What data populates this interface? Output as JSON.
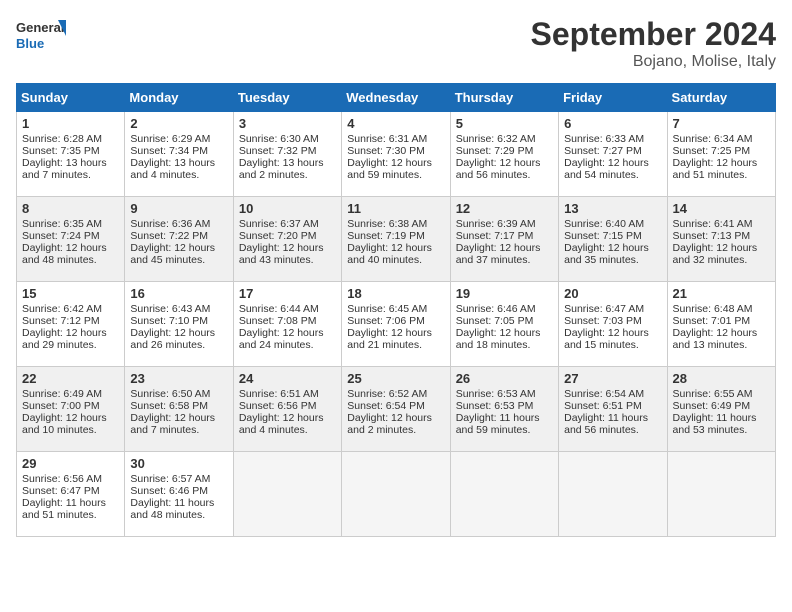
{
  "logo": {
    "line1": "General",
    "line2": "Blue"
  },
  "title": "September 2024",
  "location": "Bojano, Molise, Italy",
  "weekdays": [
    "Sunday",
    "Monday",
    "Tuesday",
    "Wednesday",
    "Thursday",
    "Friday",
    "Saturday"
  ],
  "weeks": [
    [
      {
        "day": "1",
        "sunrise": "6:28 AM",
        "sunset": "7:35 PM",
        "daylight": "13 hours and 7 minutes."
      },
      {
        "day": "2",
        "sunrise": "6:29 AM",
        "sunset": "7:34 PM",
        "daylight": "13 hours and 4 minutes."
      },
      {
        "day": "3",
        "sunrise": "6:30 AM",
        "sunset": "7:32 PM",
        "daylight": "13 hours and 2 minutes."
      },
      {
        "day": "4",
        "sunrise": "6:31 AM",
        "sunset": "7:30 PM",
        "daylight": "12 hours and 59 minutes."
      },
      {
        "day": "5",
        "sunrise": "6:32 AM",
        "sunset": "7:29 PM",
        "daylight": "12 hours and 56 minutes."
      },
      {
        "day": "6",
        "sunrise": "6:33 AM",
        "sunset": "7:27 PM",
        "daylight": "12 hours and 54 minutes."
      },
      {
        "day": "7",
        "sunrise": "6:34 AM",
        "sunset": "7:25 PM",
        "daylight": "12 hours and 51 minutes."
      }
    ],
    [
      {
        "day": "8",
        "sunrise": "6:35 AM",
        "sunset": "7:24 PM",
        "daylight": "12 hours and 48 minutes."
      },
      {
        "day": "9",
        "sunrise": "6:36 AM",
        "sunset": "7:22 PM",
        "daylight": "12 hours and 45 minutes."
      },
      {
        "day": "10",
        "sunrise": "6:37 AM",
        "sunset": "7:20 PM",
        "daylight": "12 hours and 43 minutes."
      },
      {
        "day": "11",
        "sunrise": "6:38 AM",
        "sunset": "7:19 PM",
        "daylight": "12 hours and 40 minutes."
      },
      {
        "day": "12",
        "sunrise": "6:39 AM",
        "sunset": "7:17 PM",
        "daylight": "12 hours and 37 minutes."
      },
      {
        "day": "13",
        "sunrise": "6:40 AM",
        "sunset": "7:15 PM",
        "daylight": "12 hours and 35 minutes."
      },
      {
        "day": "14",
        "sunrise": "6:41 AM",
        "sunset": "7:13 PM",
        "daylight": "12 hours and 32 minutes."
      }
    ],
    [
      {
        "day": "15",
        "sunrise": "6:42 AM",
        "sunset": "7:12 PM",
        "daylight": "12 hours and 29 minutes."
      },
      {
        "day": "16",
        "sunrise": "6:43 AM",
        "sunset": "7:10 PM",
        "daylight": "12 hours and 26 minutes."
      },
      {
        "day": "17",
        "sunrise": "6:44 AM",
        "sunset": "7:08 PM",
        "daylight": "12 hours and 24 minutes."
      },
      {
        "day": "18",
        "sunrise": "6:45 AM",
        "sunset": "7:06 PM",
        "daylight": "12 hours and 21 minutes."
      },
      {
        "day": "19",
        "sunrise": "6:46 AM",
        "sunset": "7:05 PM",
        "daylight": "12 hours and 18 minutes."
      },
      {
        "day": "20",
        "sunrise": "6:47 AM",
        "sunset": "7:03 PM",
        "daylight": "12 hours and 15 minutes."
      },
      {
        "day": "21",
        "sunrise": "6:48 AM",
        "sunset": "7:01 PM",
        "daylight": "12 hours and 13 minutes."
      }
    ],
    [
      {
        "day": "22",
        "sunrise": "6:49 AM",
        "sunset": "7:00 PM",
        "daylight": "12 hours and 10 minutes."
      },
      {
        "day": "23",
        "sunrise": "6:50 AM",
        "sunset": "6:58 PM",
        "daylight": "12 hours and 7 minutes."
      },
      {
        "day": "24",
        "sunrise": "6:51 AM",
        "sunset": "6:56 PM",
        "daylight": "12 hours and 4 minutes."
      },
      {
        "day": "25",
        "sunrise": "6:52 AM",
        "sunset": "6:54 PM",
        "daylight": "12 hours and 2 minutes."
      },
      {
        "day": "26",
        "sunrise": "6:53 AM",
        "sunset": "6:53 PM",
        "daylight": "11 hours and 59 minutes."
      },
      {
        "day": "27",
        "sunrise": "6:54 AM",
        "sunset": "6:51 PM",
        "daylight": "11 hours and 56 minutes."
      },
      {
        "day": "28",
        "sunrise": "6:55 AM",
        "sunset": "6:49 PM",
        "daylight": "11 hours and 53 minutes."
      }
    ],
    [
      {
        "day": "29",
        "sunrise": "6:56 AM",
        "sunset": "6:47 PM",
        "daylight": "11 hours and 51 minutes."
      },
      {
        "day": "30",
        "sunrise": "6:57 AM",
        "sunset": "6:46 PM",
        "daylight": "11 hours and 48 minutes."
      },
      null,
      null,
      null,
      null,
      null
    ]
  ]
}
